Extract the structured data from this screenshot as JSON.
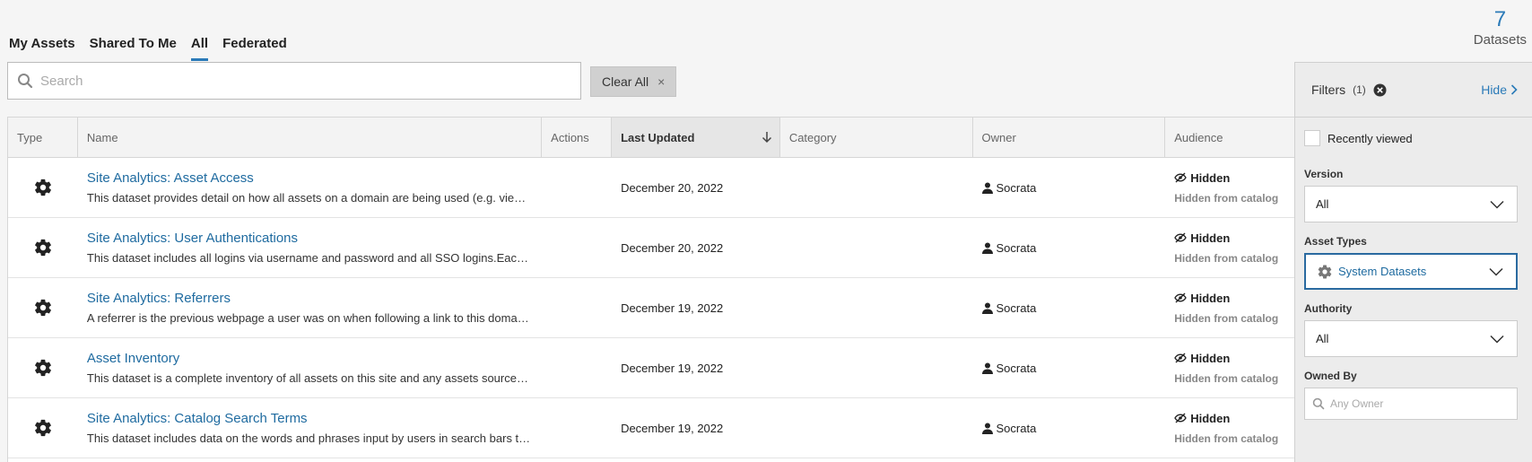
{
  "tabs": [
    {
      "label": "My Assets"
    },
    {
      "label": "Shared To Me"
    },
    {
      "label": "All"
    },
    {
      "label": "Federated"
    }
  ],
  "result_count": {
    "value": "7",
    "label": "Datasets"
  },
  "search": {
    "placeholder": "Search",
    "value": ""
  },
  "clear_all": {
    "label": "Clear All",
    "icon": "×"
  },
  "table": {
    "headers": {
      "type": "Type",
      "name": "Name",
      "actions": "Actions",
      "last_updated": "Last Updated",
      "category": "Category",
      "owner": "Owner",
      "audience": "Audience"
    },
    "rows": [
      {
        "icon": "gear-icon",
        "title": "Site Analytics: Asset Access",
        "description": "This dataset provides detail on how all assets on a domain are being used (e.g. views, downloads, etc.)",
        "updated": "December 20, 2022",
        "owner": "Socrata",
        "audience": "Hidden",
        "audience_sub": "Hidden from catalog"
      },
      {
        "icon": "gear-icon",
        "title": "Site Analytics: User Authentications",
        "description": "This dataset includes all logins via username and password and all SSO logins.Each login event is recorded",
        "updated": "December 20, 2022",
        "owner": "Socrata",
        "audience": "Hidden",
        "audience_sub": "Hidden from catalog"
      },
      {
        "icon": "gear-icon",
        "title": "Site Analytics: Referrers",
        "description": "A referrer is the previous webpage a user was on when following a link to this domain's pages",
        "updated": "December 19, 2022",
        "owner": "Socrata",
        "audience": "Hidden",
        "audience_sub": "Hidden from catalog"
      },
      {
        "icon": "gear-icon",
        "title": "Asset Inventory",
        "description": "This dataset is a complete inventory of all assets on this site and any assets sourced from other sites",
        "updated": "December 19, 2022",
        "owner": "Socrata",
        "audience": "Hidden",
        "audience_sub": "Hidden from catalog"
      },
      {
        "icon": "gear-icon",
        "title": "Site Analytics: Catalog Search Terms",
        "description": "This dataset includes data on the words and phrases input by users in search bars throughout the site",
        "updated": "December 19, 2022",
        "owner": "Socrata",
        "audience": "Hidden",
        "audience_sub": "Hidden from catalog"
      }
    ]
  },
  "filters": {
    "title": "Filters",
    "count": "(1)",
    "hide_label": "Hide",
    "recently_viewed": "Recently viewed",
    "version": {
      "label": "Version",
      "value": "All"
    },
    "asset_types": {
      "label": "Asset Types",
      "value": "System Datasets"
    },
    "authority": {
      "label": "Authority",
      "value": "All"
    },
    "owned_by": {
      "label": "Owned By",
      "placeholder": "Any Owner"
    }
  },
  "colors": {
    "accent": "#2a7ab8",
    "link": "#1f6ba0"
  }
}
